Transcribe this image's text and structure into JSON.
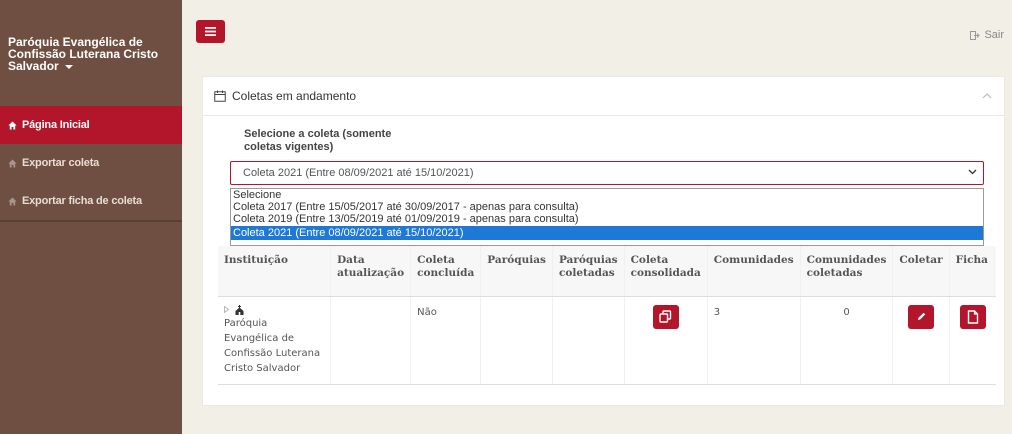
{
  "sidebar": {
    "org_name": "Paróquia Evangélica de Confissão Luterana Cristo Salvador",
    "items": [
      {
        "label": "Página Inicial",
        "icon": "home-icon",
        "active": true
      },
      {
        "label": "Exportar coleta",
        "icon": "home-icon",
        "active": false
      },
      {
        "label": "Exportar ficha de coleta",
        "icon": "home-icon",
        "active": false
      }
    ]
  },
  "header": {
    "toggle_icon": "hamburger-icon",
    "logout_label": "Sair",
    "logout_icon": "logout-icon"
  },
  "panel": {
    "title": "Coletas em andamento",
    "title_icon": "calendar-icon",
    "select_label": "Selecione a coleta (somente coletas vigentes)",
    "select_value": "Coleta 2021 (Entre 08/09/2021 até 15/10/2021)",
    "options": [
      "Selecione",
      "Coleta 2017 (Entre 15/05/2017 até 30/09/2017 - apenas para consulta)",
      "Coleta 2019 (Entre 13/05/2019 até 01/09/2019 - apenas para consulta)",
      "Coleta 2021 (Entre 08/09/2021 até 15/10/2021)"
    ],
    "selected_index": 3
  },
  "table": {
    "headers": [
      "Instituição",
      "Data atualização",
      "Coleta concluída",
      "Paróquias",
      "Paróquias coletadas",
      "Coleta consolidada",
      "Comunidades",
      "Comunidades coletadas",
      "Coletar",
      "Ficha"
    ],
    "rows": [
      {
        "instituicao": "Paróquia Evangélica de Confissão Luterana Cristo Salvador",
        "data_atualizacao": "",
        "coleta_concluida": "Não",
        "paroquias": "",
        "paroquias_coletadas": "",
        "comunidades": "3",
        "comunidades_coletadas": "0"
      }
    ]
  },
  "colors": {
    "accent": "#b3152a",
    "sidebar_bg": "#6e4f42",
    "page_bg": "#f1efe6",
    "selected_option": "#1e78d6"
  }
}
